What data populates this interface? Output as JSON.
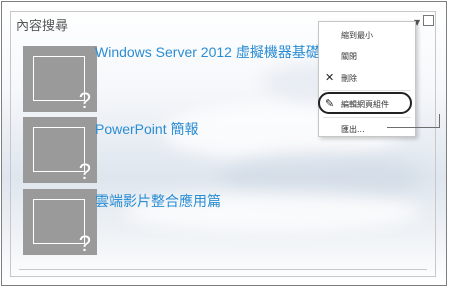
{
  "webpart": {
    "title": "內容搜尋",
    "menu_arrow": "▼"
  },
  "items": [
    {
      "title": "Windows Server 2012 虛擬機器基礎學",
      "thumb_glyph": "?"
    },
    {
      "title": "PowerPoint 簡報",
      "thumb_glyph": "?"
    },
    {
      "title": "雲端影片整合應用篇",
      "thumb_glyph": "?"
    }
  ],
  "menu": {
    "minimize": "縮到最小",
    "close": "關閉",
    "delete": "刪除",
    "edit": "編輯網頁組件",
    "export": "匯出..."
  },
  "icons": {
    "delete": "✕",
    "edit": "✎"
  }
}
